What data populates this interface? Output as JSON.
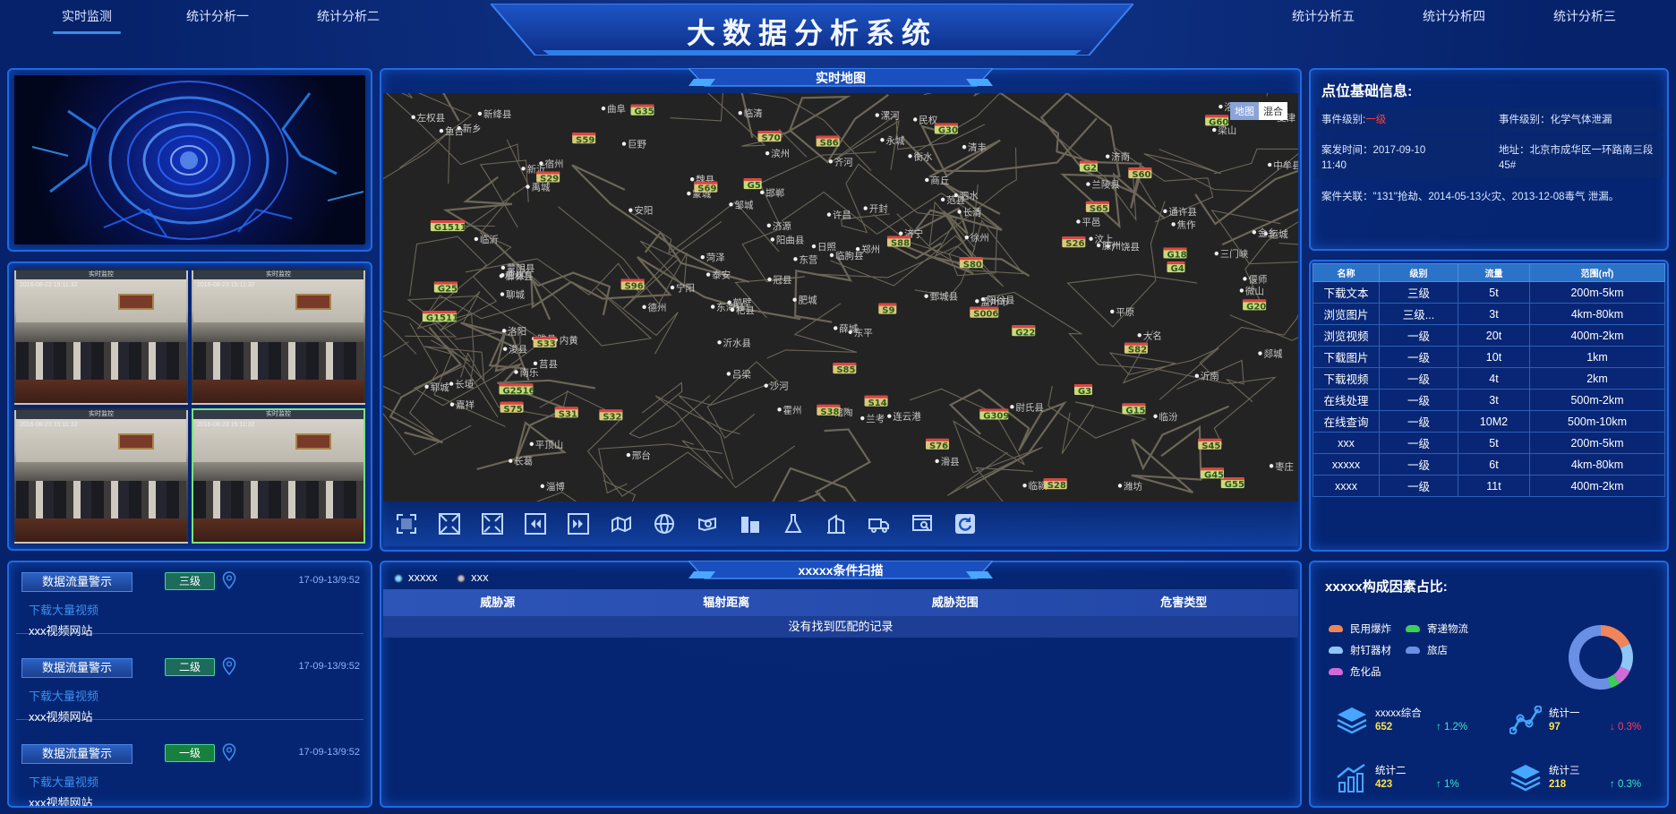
{
  "header": {
    "title": "大数据分析系统",
    "nav_left": [
      "实时监测",
      "统计分析一",
      "统计分析二"
    ],
    "nav_right": [
      "统计分析五",
      "统计分析四",
      "统计分析三"
    ],
    "active_nav": "实时监测"
  },
  "map_panel": {
    "title": "实时地图",
    "toggle": [
      "地图",
      "混合"
    ],
    "toggle_active": "地图",
    "toolbar_icons": [
      "fullscreen-icon",
      "zoom-in-icon",
      "zoom-out-icon",
      "rewind-icon",
      "fast-forward-icon",
      "map-layer-icon",
      "globe-icon",
      "camera-icon",
      "building-icon",
      "flask-icon",
      "tower-building-icon",
      "delivery-truck-icon",
      "screen-search-icon",
      "refresh-icon"
    ]
  },
  "alerts": [
    {
      "label": "数据流量警示",
      "level": "三级",
      "level_color": "#1d6b5a",
      "time": "17-09-13/9:52",
      "link": "下载大量视频",
      "site": "xxx视频网站"
    },
    {
      "label": "数据流量警示",
      "level": "二级",
      "level_color": "#1d6b5a",
      "time": "17-09-13/9:52",
      "link": "下载大量视频",
      "site": "xxx视频网站"
    },
    {
      "label": "数据流量警示",
      "level": "一级",
      "level_color": "#17803f",
      "time": "17-09-13/9:52",
      "link": "下载大量视频",
      "site": "xxx视频网站"
    }
  ],
  "info": {
    "title": "点位基础信息:",
    "event_level_label": "事件级别:",
    "event_level_value": "一级",
    "event_level2": "事件级别：化学气体泄漏",
    "time_label": "案发时间：2017-09-10",
    "time_cont": "11:40",
    "address": "地址：北京市成华区一环路南三段",
    "address_cont": "45#",
    "related": "案件关联：\"131\"抢劫、2014-05-13火灾、2013-12-08毒气 泄漏。"
  },
  "table": {
    "headers": [
      "名称",
      "级别",
      "流量",
      "范围(㎡)"
    ],
    "rows": [
      [
        "下载文本",
        "三级",
        "5t",
        "200m-5km"
      ],
      [
        "浏览图片",
        "三级...",
        "3t",
        "4km-80km"
      ],
      [
        "浏览视频",
        "一级",
        "20t",
        "400m-2km"
      ],
      [
        "下载图片",
        "一级",
        "10t",
        "1km"
      ],
      [
        "下载视频",
        "一级",
        "4t",
        "2km"
      ],
      [
        "在线处理",
        "一级",
        "3t",
        "500m-2km"
      ],
      [
        "在线查询",
        "一级",
        "10M2",
        "500m-10km"
      ],
      [
        "xxx",
        "一级",
        "5t",
        "200m-5km"
      ],
      [
        "xxxxx",
        "一级",
        "6t",
        "4km-80km"
      ],
      [
        "xxxx",
        "一级",
        "11t",
        "400m-2km"
      ]
    ]
  },
  "scan": {
    "title": "xxxxx条件扫描",
    "legend": [
      "xxxxx",
      "xxx"
    ],
    "columns": [
      "威胁源",
      "辐射距离",
      "威胁范围",
      "危害类型"
    ],
    "empty": "没有找到匹配的记录"
  },
  "factors": {
    "title": "xxxxx构成因素占比:",
    "legend": [
      {
        "name": "民用爆炸",
        "color": "#f0855a"
      },
      {
        "name": "寄递物流",
        "color": "#3ccf5a"
      },
      {
        "name": "射钉器材",
        "color": "#8ec6f5"
      },
      {
        "name": "旅店",
        "color": "#6c8fe6"
      },
      {
        "name": "危化品",
        "color": "#d26ad6"
      }
    ],
    "donut": [
      {
        "name": "民用爆炸",
        "value": 18,
        "color": "#f0855a"
      },
      {
        "name": "射钉器材",
        "value": 14,
        "color": "#8ec6f5"
      },
      {
        "name": "危化品",
        "value": 8,
        "color": "#d26ad6"
      },
      {
        "name": "寄递物流",
        "value": 5,
        "color": "#3ccf5a"
      },
      {
        "name": "旅店",
        "value": 55,
        "color": "#6c8fe6"
      }
    ],
    "stats": [
      {
        "name": "xxxxx综合",
        "value": "652",
        "change": "↑ 1.2%",
        "dir": "up",
        "icon": "layers-icon"
      },
      {
        "name": "统计一",
        "value": "97",
        "change": "↓ 0.3%",
        "dir": "down",
        "icon": "line-nodes-icon"
      },
      {
        "name": "统计二",
        "value": "423",
        "change": "↑ 1%",
        "dir": "up",
        "icon": "bar-trend-icon"
      },
      {
        "name": "统计三",
        "value": "218",
        "change": "↑ 0.3%",
        "dir": "up",
        "icon": "layers-icon"
      }
    ]
  },
  "cameras": [
    {
      "bar": "实时监控",
      "time": "2016-08-23 15:11:32"
    },
    {
      "bar": "实时监控",
      "time": "2016-08-23 15:11:32"
    },
    {
      "bar": "实时监控",
      "time": "2016-08-23 15:11:32"
    },
    {
      "bar": "实时监控",
      "time": "2016-08-23 15:11:32"
    }
  ],
  "map_labels": {
    "cities": [
      "吕梁",
      "阳曲县",
      "柳林县",
      "左权县",
      "霍州",
      "临汾",
      "新绛县",
      "运城",
      "三门峡",
      "洛宁县",
      "济源",
      "孟州市",
      "焦作",
      "新乡",
      "鹤壁",
      "安阳",
      "邢台",
      "沙河",
      "邯郸",
      "魏县",
      "聊城",
      "阳谷县",
      "范县",
      "济南",
      "泰安",
      "东营",
      "潍坊",
      "广饶县",
      "淄博",
      "临朐县",
      "沂水县",
      "临沂",
      "莒县",
      "东海县",
      "连云港",
      "新沂",
      "蒙阴县",
      "沂南",
      "兰陵县",
      "郯城",
      "日照",
      "滨州",
      "德州",
      "衡水",
      "邹城",
      "菏泽",
      "济宁",
      "枣庄",
      "东平",
      "平邑",
      "鄄城县",
      "曹县",
      "郑州",
      "开封",
      "许昌",
      "平顶山",
      "洛阳",
      "偃师",
      "中牟县",
      "尉氏县",
      "通许县",
      "杞县",
      "商丘",
      "永城",
      "徐州",
      "宿州",
      "蒙城",
      "长葛",
      "临颍",
      "漯河",
      "睢县",
      "民权",
      "兰考",
      "长垣",
      "浚县",
      "滑县",
      "内黄",
      "清丰",
      "南乐",
      "大名",
      "馆陶",
      "冠县",
      "临清",
      "夏津",
      "平原",
      "禹城",
      "齐河",
      "长清",
      "肥城",
      "宁阳",
      "曲阜",
      "泗水",
      "汶上",
      "梁山",
      "郓城",
      "巨野",
      "嘉祥",
      "金乡",
      "鱼台",
      "微山",
      "滕州",
      "薛城"
    ],
    "roads": [
      "G20",
      "S60",
      "G55",
      "G5",
      "S70",
      "G22",
      "S76",
      "G4",
      "G2516",
      "S45",
      "S9",
      "S14",
      "S006",
      "G3",
      "G35",
      "S29",
      "G18",
      "G309",
      "G2",
      "S31",
      "G25",
      "G15",
      "G1511",
      "S26",
      "S80",
      "S65",
      "S75",
      "S88",
      "S28",
      "S86",
      "G45",
      "S32",
      "S33",
      "G1511",
      "G30",
      "S85",
      "S96",
      "S59",
      "S82",
      "G60",
      "S69",
      "S38"
    ]
  }
}
